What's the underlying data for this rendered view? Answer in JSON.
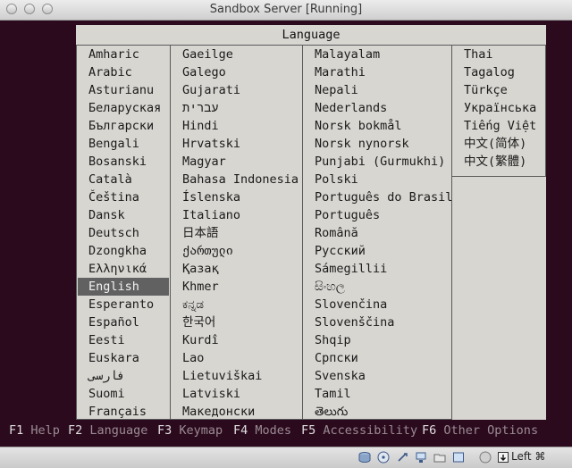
{
  "window": {
    "title": "Sandbox Server [Running]"
  },
  "dialog": {
    "title": "Language"
  },
  "columns": [
    [
      "Amharic",
      "Arabic",
      "Asturianu",
      "Беларуская",
      "Български",
      "Bengali",
      "Bosanski",
      "Català",
      "Čeština",
      "Dansk",
      "Deutsch",
      "Dzongkha",
      "Ελληνικά",
      "English",
      "Esperanto",
      "Español",
      "Eesti",
      "Euskara",
      "فارسی",
      "Suomi",
      "Français"
    ],
    [
      "Gaeilge",
      "Galego",
      "Gujarati",
      "עברית",
      "Hindi",
      "Hrvatski",
      "Magyar",
      "Bahasa Indonesia",
      "Íslenska",
      "Italiano",
      "日本語",
      "ქართული",
      "Қазақ",
      "Khmer",
      "ಕನ್ನಡ",
      "한국어",
      "Kurdî",
      "Lao",
      "Lietuviškai",
      "Latviski",
      "Македонски"
    ],
    [
      "Malayalam",
      "Marathi",
      "Nepali",
      "Nederlands",
      "Norsk bokmål",
      "Norsk nynorsk",
      "Punjabi (Gurmukhi)",
      "Polski",
      "Português do Brasil",
      "Português",
      "Română",
      "Русский",
      "Sámegillii",
      "සිංහල",
      "Slovenčina",
      "Slovenščina",
      "Shqip",
      "Српски",
      "Svenska",
      "Tamil",
      "తెలుగు"
    ],
    [
      "Thai",
      "Tagalog",
      "Türkçe",
      "Українська",
      "Tiếng Việt",
      "中文(简体)",
      "中文(繁體)"
    ]
  ],
  "selected": "English",
  "fkeys": [
    {
      "key": "F1",
      "label": "Help"
    },
    {
      "key": "F2",
      "label": "Language"
    },
    {
      "key": "F3",
      "label": "Keymap"
    },
    {
      "key": "F4",
      "label": "Modes"
    },
    {
      "key": "F5",
      "label": "Accessibility"
    },
    {
      "key": "F6",
      "label": "Other Options"
    }
  ],
  "statusbar": {
    "icons": [
      "hard-disk-icon",
      "cd-icon",
      "usb-icon",
      "network-icon",
      "shared-folder-icon",
      "display-icon",
      "capture-icon",
      "mouse-integration-icon"
    ],
    "host_key": "Left ⌘"
  },
  "colors": {
    "background": "#2c0a1e",
    "dialog": "#d8d6d1",
    "selection": "#616161"
  }
}
